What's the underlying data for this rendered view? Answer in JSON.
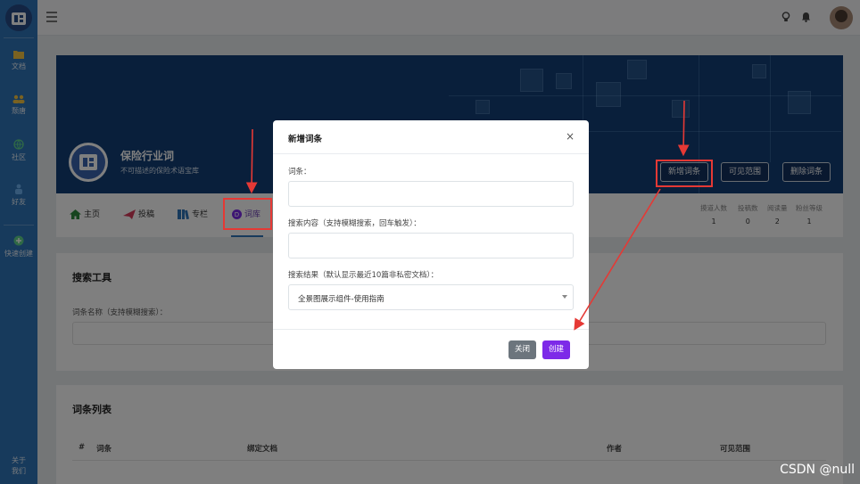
{
  "sidebar": {
    "items": [
      {
        "label": "文档",
        "icon": "folder-icon"
      },
      {
        "label": "颓唐",
        "icon": "users-icon"
      },
      {
        "label": "社区",
        "icon": "globe-icon"
      },
      {
        "label": "好友",
        "icon": "person-icon"
      },
      {
        "label": "快速创建",
        "icon": "plus-circle-icon"
      }
    ],
    "bottom_label_1": "关于",
    "bottom_label_2": "我们"
  },
  "hero": {
    "title": "保险行业词",
    "subtitle": "不可描述的保险术语宝库",
    "buttons": [
      "新增词条",
      "可见范围",
      "删除词条"
    ]
  },
  "tabs": [
    {
      "label": "主页",
      "icon": "home-icon"
    },
    {
      "label": "投稿",
      "icon": "paper-plane-icon"
    },
    {
      "label": "专栏",
      "icon": "book-icon"
    },
    {
      "label": "词库",
      "icon": "dictionary-icon",
      "active": true
    }
  ],
  "stats": [
    {
      "label": "摸道人数",
      "value": "1"
    },
    {
      "label": "投稿数",
      "value": "0"
    },
    {
      "label": "阅读量",
      "value": "2"
    },
    {
      "label": "粉丝等级",
      "value": "1"
    }
  ],
  "search_card": {
    "title": "搜索工具",
    "label": "词条名称（支持模糊搜索）："
  },
  "list_card": {
    "title": "词条列表",
    "headers": [
      "#",
      "词条",
      "绑定文档",
      "作者",
      "可见范围"
    ]
  },
  "modal": {
    "title": "新增词条",
    "close_symbol": "×",
    "field1_label": "词条：",
    "field2_label": "搜索内容（支持模糊搜索，回车触发）：",
    "field3_label": "搜索结果（默认显示最近10篇非私密文档）：",
    "select_value": "全景图展示组件-使用指南",
    "close_button": "关闭",
    "create_button": "创建"
  },
  "watermark": "CSDN @null",
  "colors": {
    "sidebar": "#2f74b8",
    "hero": "#123f77",
    "primary": "#7d2ae8",
    "annotation": "#e53935"
  }
}
